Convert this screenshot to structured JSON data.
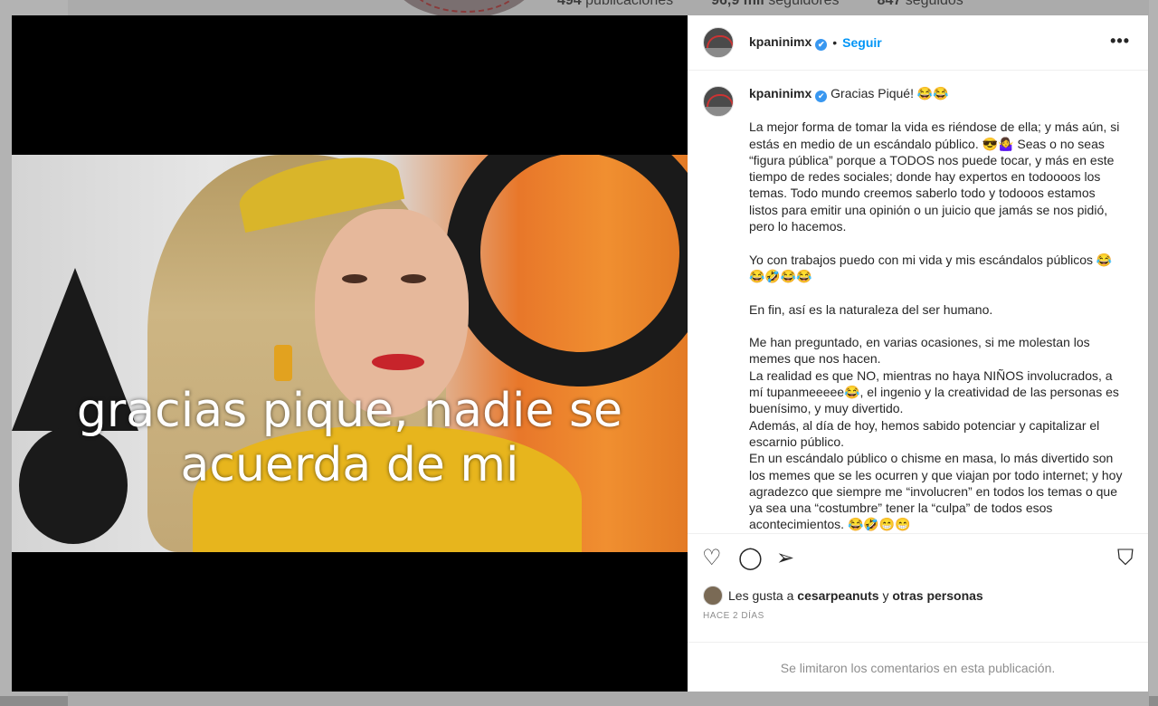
{
  "background": {
    "stats": [
      {
        "value": "494",
        "label": "publicaciones"
      },
      {
        "value": "96,9 mil",
        "label": "seguidores"
      },
      {
        "value": "847",
        "label": "seguidos"
      }
    ]
  },
  "media": {
    "caption_line1": "gracias pique, nadie se",
    "caption_line2": "acuerda de mi"
  },
  "header": {
    "username": "kpaninimx",
    "verified_icon": "✔",
    "separator": "•",
    "follow_label": "Seguir",
    "more_icon": "•••"
  },
  "post": {
    "username": "kpaninimx",
    "first_line": "Gracias Piqué! 😂😂",
    "paragraphs": [
      "La mejor forma de tomar la vida es riéndose de ella; y más aún, si estás en medio de un escándalo público. 😎🤷‍♀️ Seas o no seas “figura pública” porque a TODOS nos puede tocar, y más en este tiempo de redes sociales; donde hay expertos en todoooos los temas. Todo mundo creemos saberlo todo y todooos estamos listos para emitir una opinión o un juicio que jamás se nos pidió, pero lo hacemos.",
      "Yo con trabajos puedo con mi vida y mis escándalos públicos 😂😂🤣😂😂",
      "En fin, así es la naturaleza del ser humano.",
      "Me han preguntado, en varias ocasiones, si me molestan los memes que nos hacen.\nLa realidad es que NO, mientras no haya NIÑOS involucrados, a mí tupanmeeeee😂, el ingenio y la creatividad de las personas es buenísimo, y muy divertido.\nAdemás, al día de hoy, hemos sabido potenciar y capitalizar el escarnio público.\nEn un escándalo público o chisme en masa, lo más divertido son los memes que se les ocurren y que viajan por todo internet; y hoy agradezco que siempre me “involucren” en todos los temas o que ya sea una “costumbre” tener la “culpa” de todos esos acontecimientos. 😂🤣😁😁"
    ]
  },
  "actions": {
    "like_icon": "♡",
    "comment_icon": "◯",
    "share_icon": "➢",
    "save_icon": "⛉"
  },
  "likes": {
    "prefix": "Les gusta a ",
    "user": "cesarpeanuts",
    "joiner": " y ",
    "others": "otras personas"
  },
  "timestamp": "HACE 2 DÍAS",
  "comments_limited": "Se limitaron los comentarios en esta publicación."
}
